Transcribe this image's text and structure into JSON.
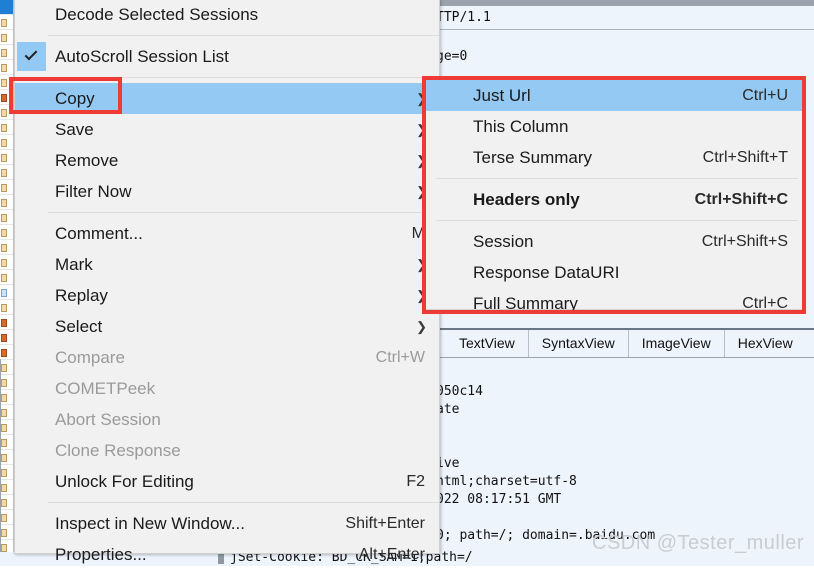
{
  "app": {
    "request_line": "TTP/1.1",
    "request_extra": "ge=0",
    "bottom_line": "jSet-Cookie: BD_CK_SAM=1;path=/",
    "watermark": "CSDN @Tester_muller",
    "tabs": [
      {
        "label": "TextView"
      },
      {
        "label": "SyntaxView"
      },
      {
        "label": "ImageView"
      },
      {
        "label": "HexView"
      }
    ],
    "response_lines": [
      "050c14",
      "ate",
      "",
      "",
      "ive",
      "html;charset=utf-8",
      "022 08:17:51 GMT",
      "",
      "0; path=/; domain=.baidu.com"
    ]
  },
  "context_menu": {
    "items": [
      {
        "label": "Decode Selected Sessions",
        "accel": "",
        "arrow": false,
        "disabled": false,
        "checked": false,
        "highlight": false,
        "bold": false
      },
      {
        "separator": true
      },
      {
        "label": "AutoScroll Session List",
        "accel": "",
        "arrow": false,
        "disabled": false,
        "checked": true,
        "highlight": false,
        "bold": false
      },
      {
        "separator": true
      },
      {
        "label": "Copy",
        "accel": "",
        "arrow": true,
        "disabled": false,
        "checked": false,
        "highlight": true,
        "bold": false
      },
      {
        "label": "Save",
        "accel": "",
        "arrow": true,
        "disabled": false,
        "checked": false,
        "highlight": false,
        "bold": false
      },
      {
        "label": "Remove",
        "accel": "",
        "arrow": true,
        "disabled": false,
        "checked": false,
        "highlight": false,
        "bold": false
      },
      {
        "label": "Filter Now",
        "accel": "",
        "arrow": true,
        "disabled": false,
        "checked": false,
        "highlight": false,
        "bold": false
      },
      {
        "separator": true
      },
      {
        "label": "Comment...",
        "accel": "M",
        "arrow": false,
        "disabled": false,
        "checked": false,
        "highlight": false,
        "bold": false
      },
      {
        "label": "Mark",
        "accel": "",
        "arrow": true,
        "disabled": false,
        "checked": false,
        "highlight": false,
        "bold": false
      },
      {
        "label": "Replay",
        "accel": "",
        "arrow": true,
        "disabled": false,
        "checked": false,
        "highlight": false,
        "bold": false
      },
      {
        "label": "Select",
        "accel": "",
        "arrow": true,
        "disabled": false,
        "checked": false,
        "highlight": false,
        "bold": false
      },
      {
        "label": "Compare",
        "accel": "Ctrl+W",
        "arrow": false,
        "disabled": true,
        "checked": false,
        "highlight": false,
        "bold": false
      },
      {
        "label": "COMETPeek",
        "accel": "",
        "arrow": false,
        "disabled": true,
        "checked": false,
        "highlight": false,
        "bold": false
      },
      {
        "label": "Abort Session",
        "accel": "",
        "arrow": false,
        "disabled": true,
        "checked": false,
        "highlight": false,
        "bold": false
      },
      {
        "label": "Clone Response",
        "accel": "",
        "arrow": false,
        "disabled": true,
        "checked": false,
        "highlight": false,
        "bold": false
      },
      {
        "label": "Unlock For Editing",
        "accel": "F2",
        "arrow": false,
        "disabled": false,
        "checked": false,
        "highlight": false,
        "bold": false
      },
      {
        "separator": true
      },
      {
        "label": "Inspect in New Window...",
        "accel": "Shift+Enter",
        "arrow": false,
        "disabled": false,
        "checked": false,
        "highlight": false,
        "bold": false
      },
      {
        "label": "Properties...",
        "accel": "Alt+Enter",
        "arrow": false,
        "disabled": false,
        "checked": false,
        "highlight": false,
        "bold": false
      }
    ]
  },
  "copy_submenu": {
    "items": [
      {
        "label": "Just Url",
        "accel": "Ctrl+U",
        "highlight": true,
        "bold": false
      },
      {
        "label": "This Column",
        "accel": "",
        "highlight": false,
        "bold": false
      },
      {
        "label": "Terse Summary",
        "accel": "Ctrl+Shift+T",
        "highlight": false,
        "bold": false
      },
      {
        "separator": true
      },
      {
        "label": "Headers only",
        "accel": "Ctrl+Shift+C",
        "highlight": false,
        "bold": true
      },
      {
        "separator": true
      },
      {
        "label": "Session",
        "accel": "Ctrl+Shift+S",
        "highlight": false,
        "bold": false
      },
      {
        "label": "Response DataURI",
        "accel": "",
        "highlight": false,
        "bold": false
      },
      {
        "label": "Full Summary",
        "accel": "Ctrl+C",
        "highlight": false,
        "bold": false
      }
    ]
  },
  "annotations": {
    "highlight_color": "#ef3b36",
    "boxes": [
      {
        "name": "copy-item-box"
      },
      {
        "name": "copy-submenu-box"
      }
    ]
  },
  "colors": {
    "menu_bg": "#f1f1f1",
    "menu_highlight": "#93c9f2",
    "pane_bg": "#eef4fc",
    "annotation_red": "#ef3b36"
  }
}
